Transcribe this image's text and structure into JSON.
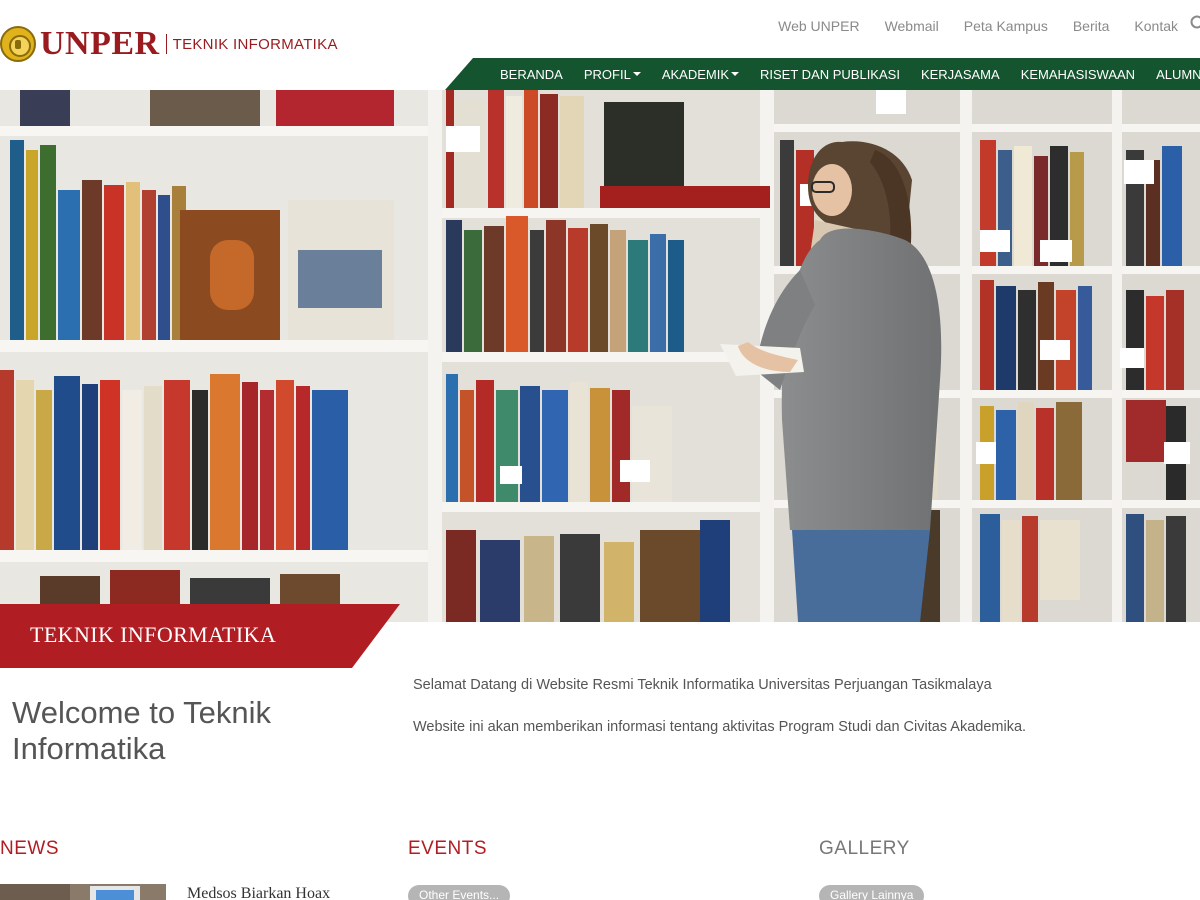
{
  "header": {
    "logo_name": "UNPER",
    "logo_dept": "TEKNIK INFORMATIKA",
    "top_links": [
      "Web UNPER",
      "Webmail",
      "Peta Kampus",
      "Berita",
      "Kontak"
    ],
    "nav": [
      {
        "label": "BERANDA",
        "dropdown": false
      },
      {
        "label": "PROFIL",
        "dropdown": true
      },
      {
        "label": "AKADEMIK",
        "dropdown": true
      },
      {
        "label": "RISET DAN PUBLIKASI",
        "dropdown": false
      },
      {
        "label": "KERJASAMA",
        "dropdown": false
      },
      {
        "label": "KEMAHASISWAAN",
        "dropdown": false
      },
      {
        "label": "ALUMNI",
        "dropdown": false
      }
    ]
  },
  "hero": {
    "banner": "TEKNIK INFORMATIKA"
  },
  "welcome": {
    "title": "Welcome to Teknik Informatika",
    "paragraph_1": "Selamat Datang di Website Resmi Teknik Informatika Universitas Perjuangan Tasikmalaya",
    "paragraph_2": "Website ini akan memberikan informasi tentang aktivitas Program Studi dan Civitas Akademika."
  },
  "sections": {
    "news": {
      "title": "NEWS",
      "first_headline": "Medsos Biarkan Hoax"
    },
    "events": {
      "title": "EVENTS",
      "more_label": "Other Events..."
    },
    "gallery": {
      "title": "GALLERY",
      "more_label": "Gallery Lainnya"
    }
  },
  "colors": {
    "brand_red": "#b01e23",
    "nav_green": "#14552f",
    "muted_link": "#8a8a8a"
  },
  "icons": {
    "search": "search-icon",
    "dropdown": "caret-down-icon",
    "logo": "university-emblem-icon"
  }
}
